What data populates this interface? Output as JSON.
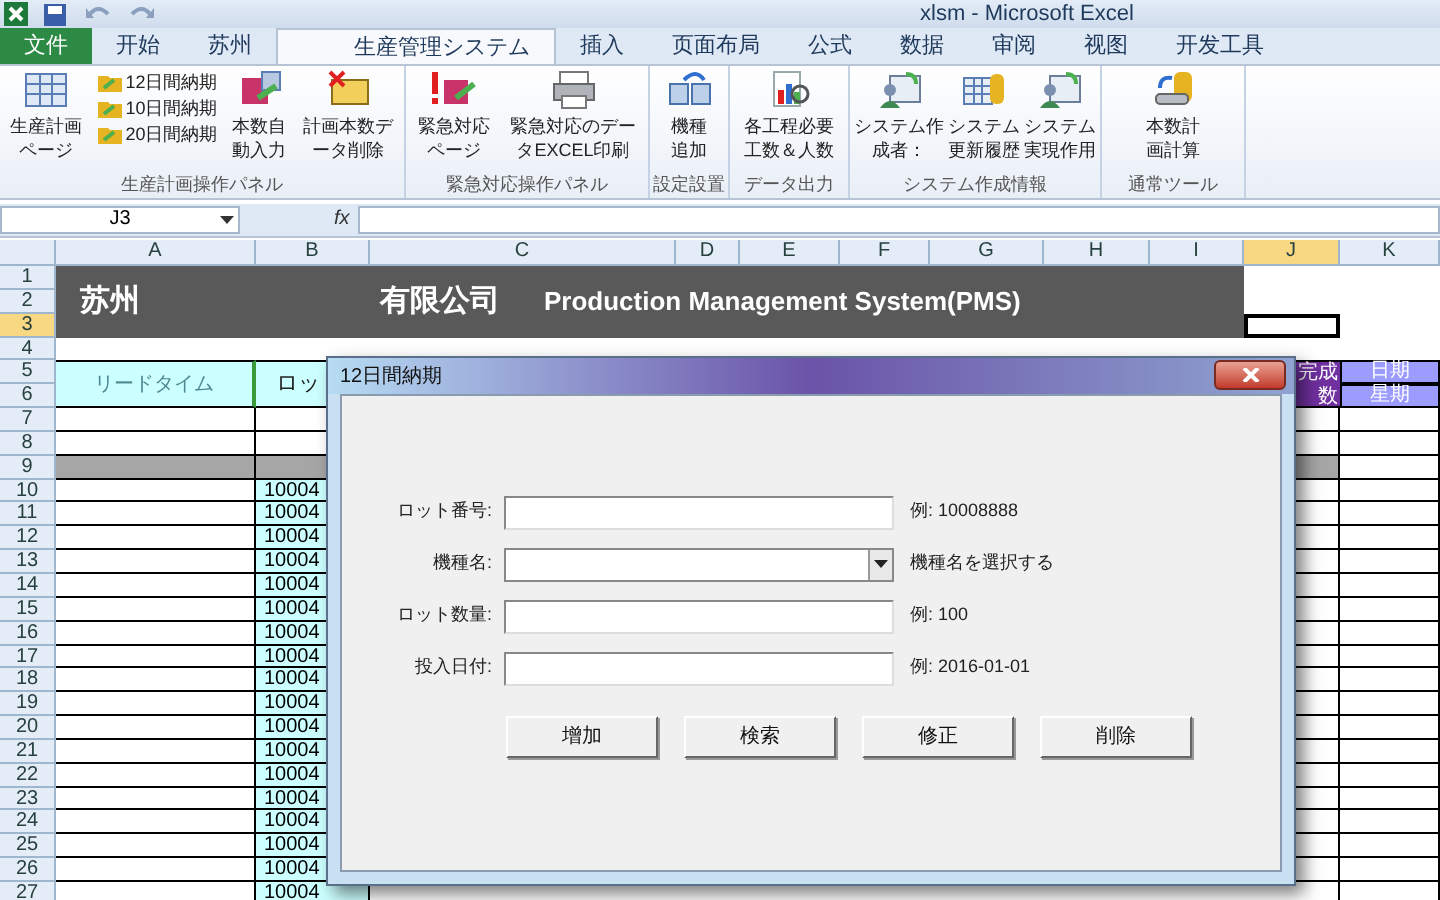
{
  "window": {
    "title": "xlsm  -  Microsoft Excel"
  },
  "ribbon_tabs": [
    {
      "label": "文件",
      "kind": "file",
      "selected": false
    },
    {
      "label": "开始",
      "kind": "tab",
      "selected": false
    },
    {
      "label": "苏州",
      "kind": "tab",
      "selected": false
    },
    {
      "label": "生産管理システム",
      "kind": "tab",
      "selected": true
    },
    {
      "label": "插入",
      "kind": "tab",
      "selected": false
    },
    {
      "label": "页面布局",
      "kind": "tab",
      "selected": false
    },
    {
      "label": "公式",
      "kind": "tab",
      "selected": false
    },
    {
      "label": "数据",
      "kind": "tab",
      "selected": false
    },
    {
      "label": "审阅",
      "kind": "tab",
      "selected": false
    },
    {
      "label": "视图",
      "kind": "tab",
      "selected": false
    },
    {
      "label": "开发工具",
      "kind": "tab",
      "selected": false
    }
  ],
  "ribbon_groups": [
    {
      "label": "生産計画操作パネル",
      "items": [
        {
          "kind": "large",
          "lines": [
            "生産計画",
            "ページ"
          ]
        },
        {
          "kind": "stack",
          "entries": [
            "12日間納期",
            "10日間納期",
            "20日間納期"
          ]
        },
        {
          "kind": "large",
          "lines": [
            "本数自",
            "動入力"
          ]
        },
        {
          "kind": "large",
          "lines": [
            "計画本数デ",
            "ータ削除"
          ]
        }
      ]
    },
    {
      "label": "緊急対応操作パネル",
      "items": [
        {
          "kind": "large",
          "lines": [
            "緊急対応",
            "ページ"
          ]
        },
        {
          "kind": "large",
          "lines": [
            "緊急対応のデー",
            "タEXCEL印刷"
          ]
        }
      ]
    },
    {
      "label": "設定設置",
      "items": [
        {
          "kind": "large",
          "lines": [
            "機種",
            "追加"
          ]
        }
      ]
    },
    {
      "label": "データ出力",
      "items": [
        {
          "kind": "large",
          "lines": [
            "各工程必要",
            "工数＆人数"
          ]
        }
      ]
    },
    {
      "label": "システム作成情報",
      "items": [
        {
          "kind": "large",
          "lines": [
            "システム作",
            "成者："
          ]
        },
        {
          "kind": "large",
          "lines": [
            "システム",
            "更新履歴"
          ]
        },
        {
          "kind": "large",
          "lines": [
            "システム",
            "実現作用"
          ]
        }
      ]
    },
    {
      "label": "通常ツール",
      "items": [
        {
          "kind": "large",
          "lines": [
            "本数計",
            "画計算"
          ]
        }
      ]
    }
  ],
  "name_box": "J3",
  "formula_label": "fx",
  "columns": [
    {
      "label": "A",
      "selected": false
    },
    {
      "label": "B",
      "selected": false
    },
    {
      "label": "C",
      "selected": false
    },
    {
      "label": "D",
      "selected": false
    },
    {
      "label": "E",
      "selected": false
    },
    {
      "label": "F",
      "selected": false
    },
    {
      "label": "G",
      "selected": false
    },
    {
      "label": "H",
      "selected": false
    },
    {
      "label": "I",
      "selected": false
    },
    {
      "label": "J",
      "selected": true
    },
    {
      "label": "K",
      "selected": false
    }
  ],
  "rows": [
    {
      "label": "1",
      "kind": "title",
      "selected": false
    },
    {
      "label": "2",
      "kind": "title",
      "selected": false
    },
    {
      "label": "3",
      "kind": "title",
      "selected": true
    },
    {
      "label": "4",
      "kind": "blank",
      "selected": false
    },
    {
      "label": "5",
      "kind": "header",
      "selected": false
    },
    {
      "label": "6",
      "kind": "header",
      "selected": false
    },
    {
      "label": "7",
      "kind": "data",
      "selected": false
    },
    {
      "label": "8",
      "kind": "data",
      "selected": false
    },
    {
      "label": "9",
      "kind": "separator",
      "selected": false
    },
    {
      "label": "10",
      "kind": "data",
      "selected": false,
      "lot": "10004"
    },
    {
      "label": "11",
      "kind": "data",
      "selected": false,
      "lot": "10004"
    },
    {
      "label": "12",
      "kind": "data",
      "selected": false,
      "lot": "10004"
    },
    {
      "label": "13",
      "kind": "data",
      "selected": false,
      "lot": "10004"
    },
    {
      "label": "14",
      "kind": "data",
      "selected": false,
      "lot": "10004"
    },
    {
      "label": "15",
      "kind": "data",
      "selected": false,
      "lot": "10004"
    },
    {
      "label": "16",
      "kind": "data",
      "selected": false,
      "lot": "10004"
    },
    {
      "label": "17",
      "kind": "data",
      "selected": false,
      "lot": "10004"
    },
    {
      "label": "18",
      "kind": "data",
      "selected": false,
      "lot": "10004"
    },
    {
      "label": "19",
      "kind": "data",
      "selected": false,
      "lot": "10004"
    },
    {
      "label": "20",
      "kind": "data",
      "selected": false,
      "lot": "10004"
    },
    {
      "label": "21",
      "kind": "data",
      "selected": false,
      "lot": "10004"
    },
    {
      "label": "22",
      "kind": "data",
      "selected": false,
      "lot": "10004"
    },
    {
      "label": "23",
      "kind": "data",
      "selected": false,
      "lot": "10004"
    },
    {
      "label": "24",
      "kind": "data",
      "selected": false,
      "lot": "10004"
    },
    {
      "label": "25",
      "kind": "data",
      "selected": false,
      "lot": "10004"
    },
    {
      "label": "26",
      "kind": "data",
      "selected": false,
      "lot": "10004"
    },
    {
      "label": "27",
      "kind": "data",
      "selected": false,
      "lot": "10004"
    }
  ],
  "sheet": {
    "company_prefix": "苏州",
    "company_suffix": "有限公司",
    "system_title": "Production Management System(PMS)",
    "header": {
      "column_a": "リードタイム",
      "column_b": "ロッ",
      "column_j": [
        "完成",
        "数"
      ],
      "column_k": [
        "日期",
        "星期"
      ]
    }
  },
  "dialog": {
    "title": "12日間納期",
    "fields": [
      {
        "label": "ロット番号:",
        "kind": "text",
        "hint": "例: 10008888"
      },
      {
        "label": "機種名:",
        "kind": "dropdown",
        "hint": "機種名を選択する"
      },
      {
        "label": "ロット数量:",
        "kind": "text",
        "hint": "例: 100"
      },
      {
        "label": "投入日付:",
        "kind": "text",
        "hint": "例: 2016-01-01"
      }
    ],
    "buttons": [
      "增加",
      "検索",
      "修正",
      "削除"
    ]
  }
}
